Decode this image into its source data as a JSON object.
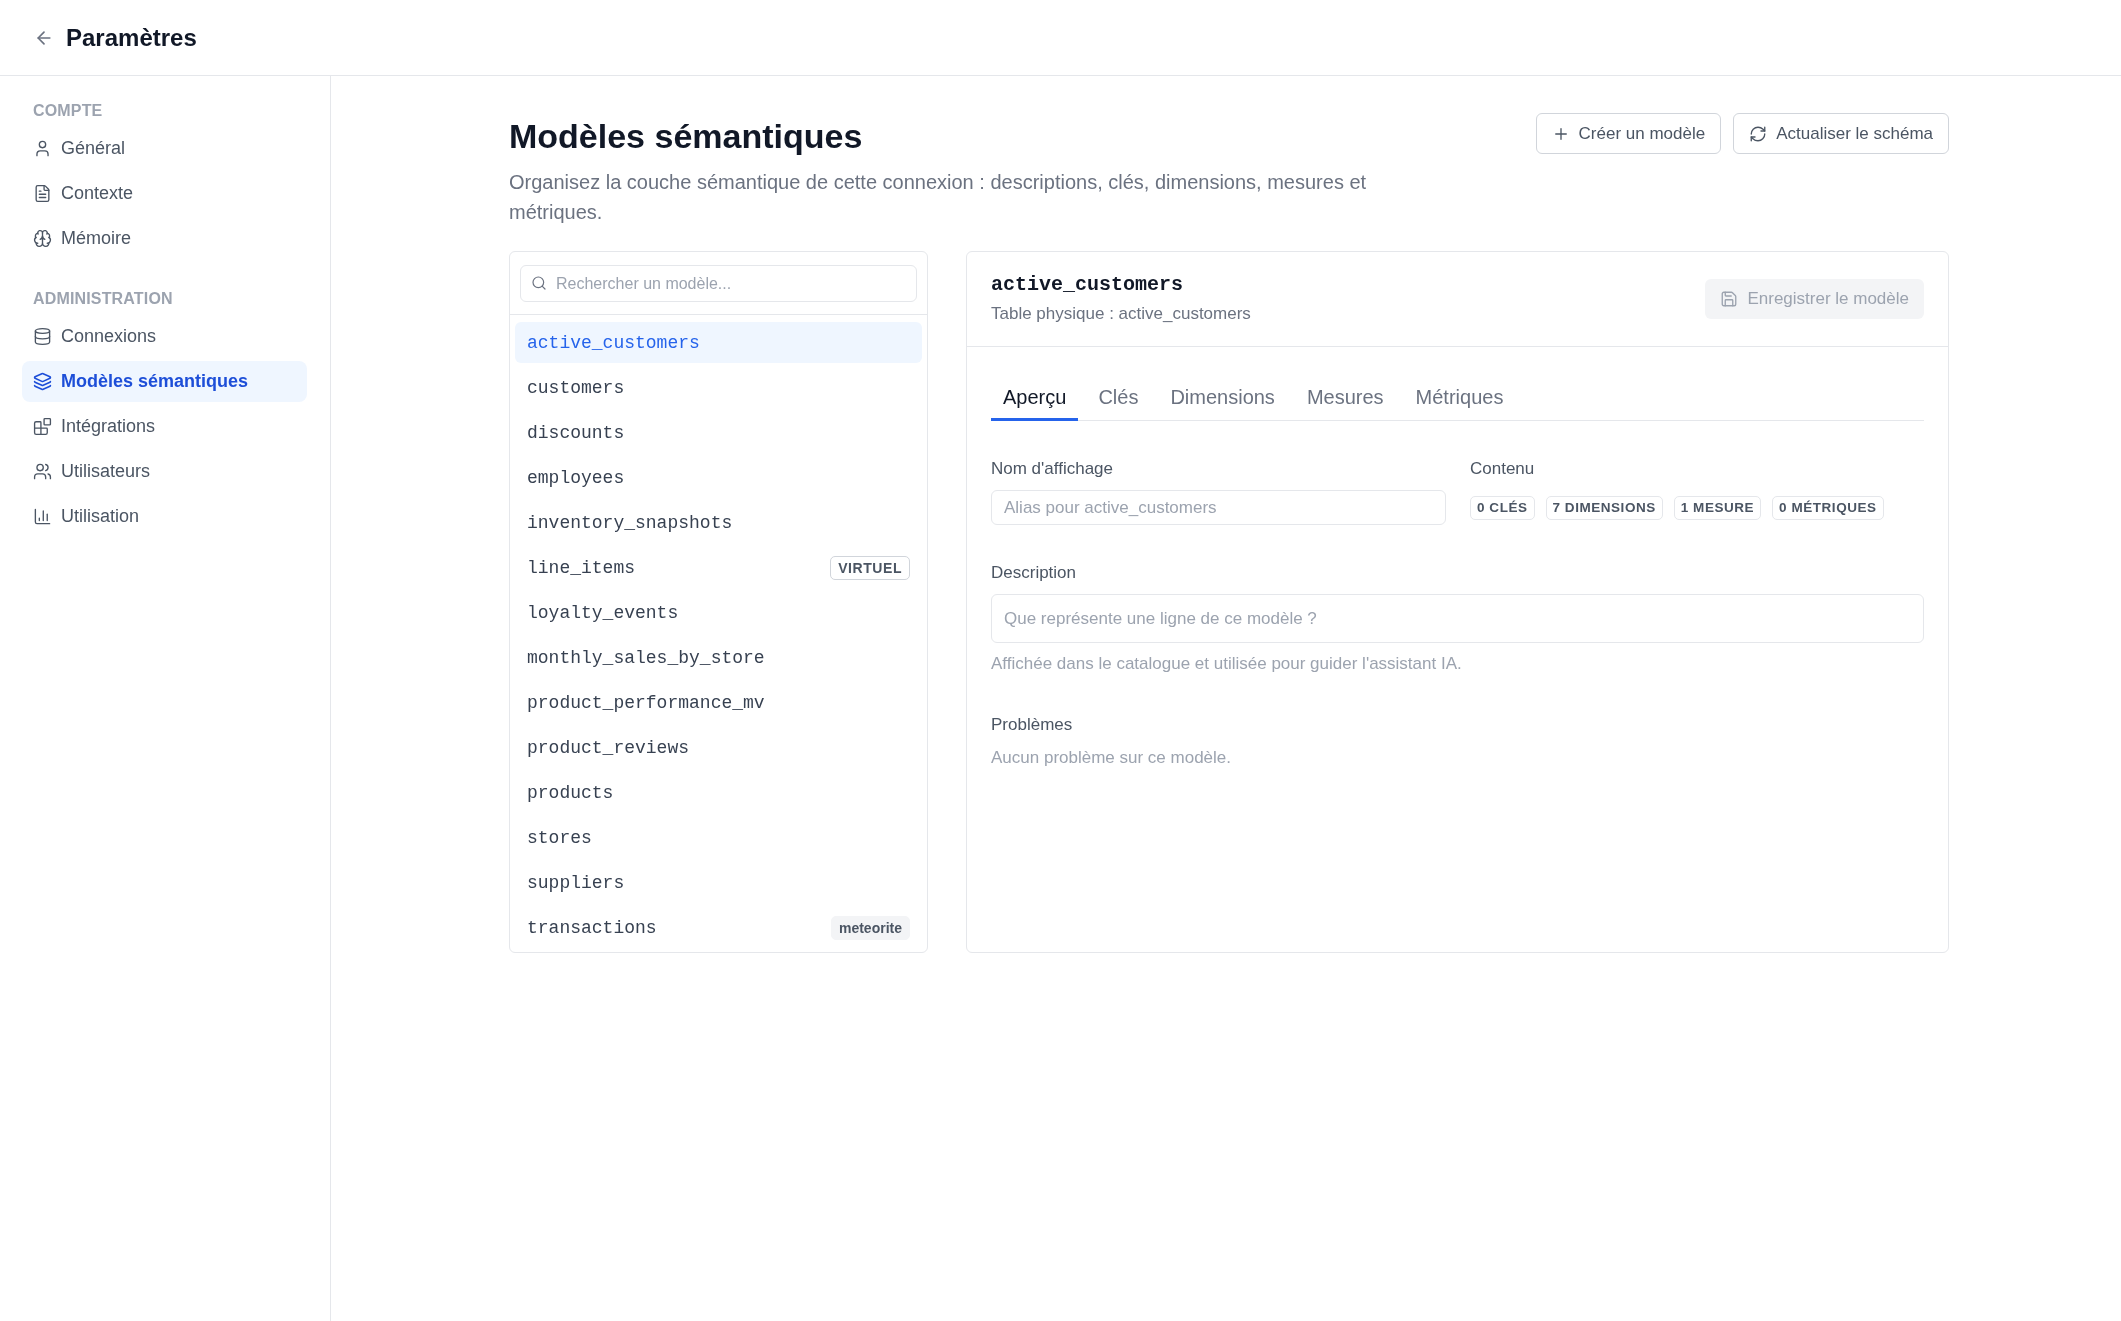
{
  "header": {
    "title": "Paramètres"
  },
  "sidebar": {
    "sections": [
      {
        "label": "COMPTE",
        "items": [
          {
            "label": "Général",
            "selected": false
          },
          {
            "label": "Contexte",
            "selected": false
          },
          {
            "label": "Mémoire",
            "selected": false
          }
        ]
      },
      {
        "label": "ADMINISTRATION",
        "items": [
          {
            "label": "Connexions",
            "selected": false
          },
          {
            "label": "Modèles sémantiques",
            "selected": true
          },
          {
            "label": "Intégrations",
            "selected": false
          },
          {
            "label": "Utilisateurs",
            "selected": false
          },
          {
            "label": "Utilisation",
            "selected": false
          }
        ]
      }
    ]
  },
  "page": {
    "title": "Modèles sémantiques",
    "description": "Organisez la couche sémantique de cette connexion : descriptions, clés, dimensions, mesures et métriques.",
    "actions": [
      "Créer un modèle",
      "Actualiser le schéma"
    ]
  },
  "models": {
    "search": {
      "placeholder": "Rechercher un modèle..."
    },
    "items": [
      {
        "name": "active_customers",
        "selected": true
      },
      {
        "name": "customers",
        "selected": false
      },
      {
        "name": "discounts",
        "selected": false
      },
      {
        "name": "employees",
        "selected": false
      },
      {
        "name": "inventory_snapshots",
        "selected": false
      },
      {
        "name": "line_items",
        "selected": false,
        "badge": {
          "text": "VIRTUEL",
          "kind": "outline"
        }
      },
      {
        "name": "loyalty_events",
        "selected": false
      },
      {
        "name": "monthly_sales_by_store",
        "selected": false
      },
      {
        "name": "product_performance_mv",
        "selected": false
      },
      {
        "name": "product_reviews",
        "selected": false
      },
      {
        "name": "products",
        "selected": false
      },
      {
        "name": "stores",
        "selected": false
      },
      {
        "name": "suppliers",
        "selected": false
      },
      {
        "name": "transactions",
        "selected": false,
        "badge": {
          "text": "meteorite",
          "kind": "filled"
        }
      }
    ]
  },
  "detail": {
    "name": "active_customers",
    "subtitle": "Table physique : active_customers",
    "save_button": {
      "label": "Enregistrer le modèle",
      "disabled": true
    },
    "tabs": [
      {
        "label": "Aperçu",
        "selected": true
      },
      {
        "label": "Clés",
        "selected": false
      },
      {
        "label": "Dimensions",
        "selected": false
      },
      {
        "label": "Mesures",
        "selected": false
      },
      {
        "label": "Métriques",
        "selected": false
      }
    ],
    "display_name": {
      "label": "Nom d'affichage",
      "placeholder": "Alias pour active_customers"
    },
    "content": {
      "label": "Contenu",
      "counts": [
        "0 CLÉS",
        "7 DIMENSIONS",
        "1 MESURE",
        "0 MÉTRIQUES"
      ]
    },
    "description": {
      "label": "Description",
      "placeholder": "Que représente une ligne de ce modèle ?",
      "help": "Affichée dans le catalogue et utilisée pour guider l'assistant IA."
    },
    "problems": {
      "label": "Problèmes",
      "text": "Aucun problème sur ce modèle."
    }
  }
}
